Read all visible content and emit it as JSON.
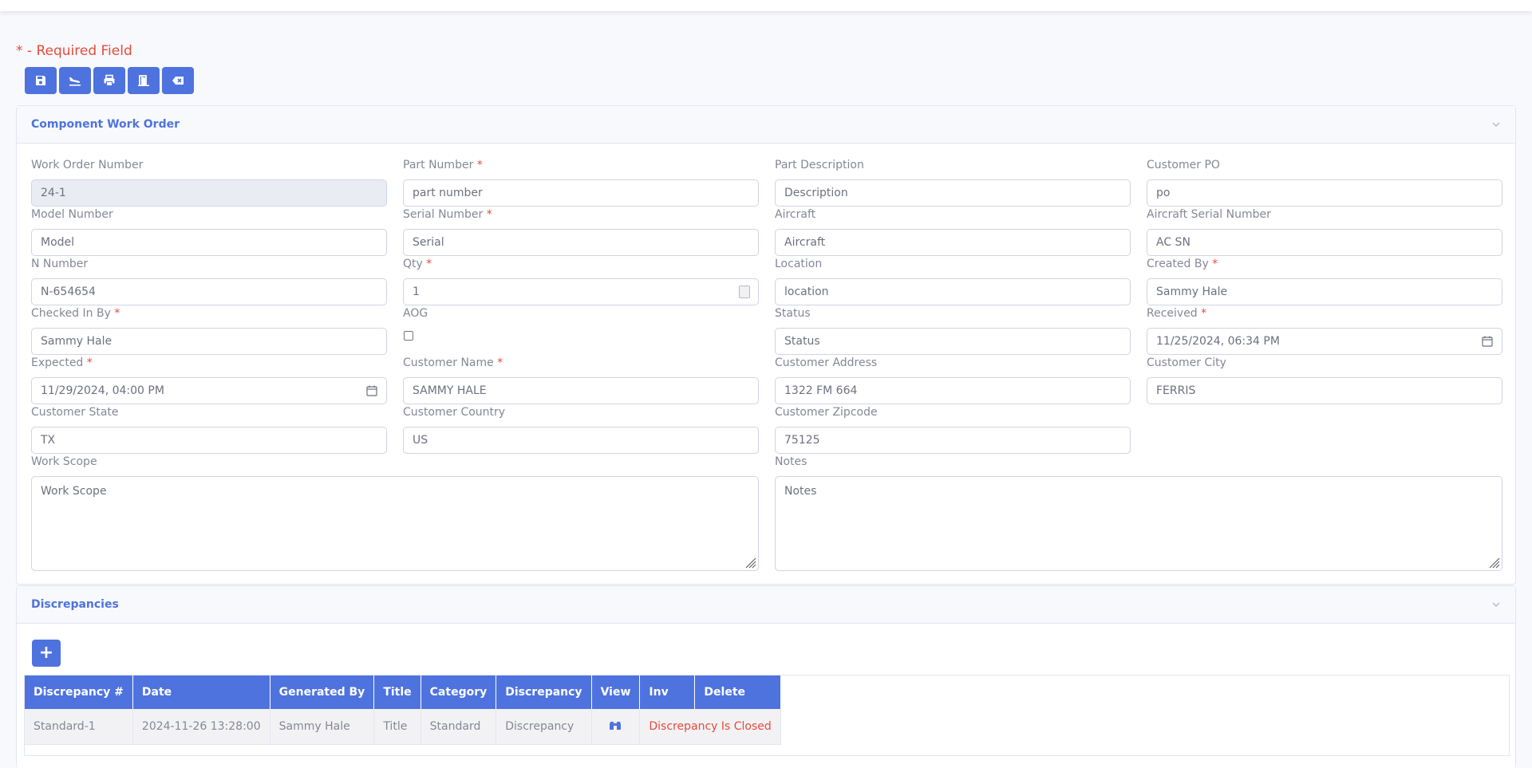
{
  "required_note": "* - Required Field",
  "toolbar": [
    {
      "icon": "save-icon"
    },
    {
      "icon": "airplane-land-icon"
    },
    {
      "icon": "print-icon"
    },
    {
      "icon": "door-icon"
    },
    {
      "icon": "backspace-icon"
    }
  ],
  "component_card": {
    "title": "Component Work Order",
    "fields": {
      "work_order_number": {
        "label": "Work Order Number",
        "value": "24-1"
      },
      "part_number": {
        "label": "Part Number",
        "placeholder": "part number"
      },
      "part_description": {
        "label": "Part Description",
        "placeholder": "Description"
      },
      "customer_po": {
        "label": "Customer PO",
        "placeholder": "po"
      },
      "model_number": {
        "label": "Model Number",
        "placeholder": "Model"
      },
      "serial_number": {
        "label": "Serial Number",
        "placeholder": "Serial"
      },
      "aircraft": {
        "label": "Aircraft",
        "placeholder": "Aircraft"
      },
      "aircraft_serial": {
        "label": "Aircraft Serial Number",
        "placeholder": "AC SN"
      },
      "n_number": {
        "label": "N Number",
        "value": "N-654654"
      },
      "qty": {
        "label": "Qty",
        "value": "1"
      },
      "location": {
        "label": "Location",
        "placeholder": "location"
      },
      "created_by": {
        "label": "Created By",
        "value": "Sammy Hale"
      },
      "checked_in_by": {
        "label": "Checked In By",
        "value": "Sammy Hale"
      },
      "aog": {
        "label": "AOG",
        "checked": false
      },
      "status": {
        "label": "Status",
        "placeholder": "Status"
      },
      "received": {
        "label": "Received",
        "value": "11/25/2024, 06:34 PM"
      },
      "expected": {
        "label": "Expected",
        "value": "11/29/2024, 04:00 PM"
      },
      "customer_name": {
        "label": "Customer Name",
        "value": "SAMMY HALE"
      },
      "customer_address": {
        "label": "Customer Address",
        "value": "1322 FM 664"
      },
      "customer_city": {
        "label": "Customer City",
        "value": "FERRIS"
      },
      "customer_state": {
        "label": "Customer State",
        "value": "TX"
      },
      "customer_country": {
        "label": "Customer Country",
        "value": "US"
      },
      "customer_zipcode": {
        "label": "Customer Zipcode",
        "value": "75125"
      },
      "work_scope": {
        "label": "Work Scope",
        "placeholder": "Work Scope"
      },
      "notes": {
        "label": "Notes",
        "placeholder": "Notes"
      }
    },
    "required_mark": "*"
  },
  "discrepancies_card": {
    "title": "Discrepancies",
    "add_label": "+",
    "columns": [
      "Discrepancy #",
      "Date",
      "Generated By",
      "Title",
      "Category",
      "Discrepancy",
      "View",
      "Inv",
      "Delete"
    ],
    "rows": [
      {
        "number": "Standard-1",
        "date": "2024-11-26 13:28:00",
        "generated_by": "Sammy Hale",
        "title": "Title",
        "category": "Standard",
        "discrepancy": "Discrepancy",
        "view_icon": "binoculars-icon",
        "inv_delete": "Discrepancy Is Closed"
      }
    ]
  },
  "colors": {
    "primary": "#4e73df",
    "danger": "#e74a3b",
    "muted": "#858796"
  }
}
